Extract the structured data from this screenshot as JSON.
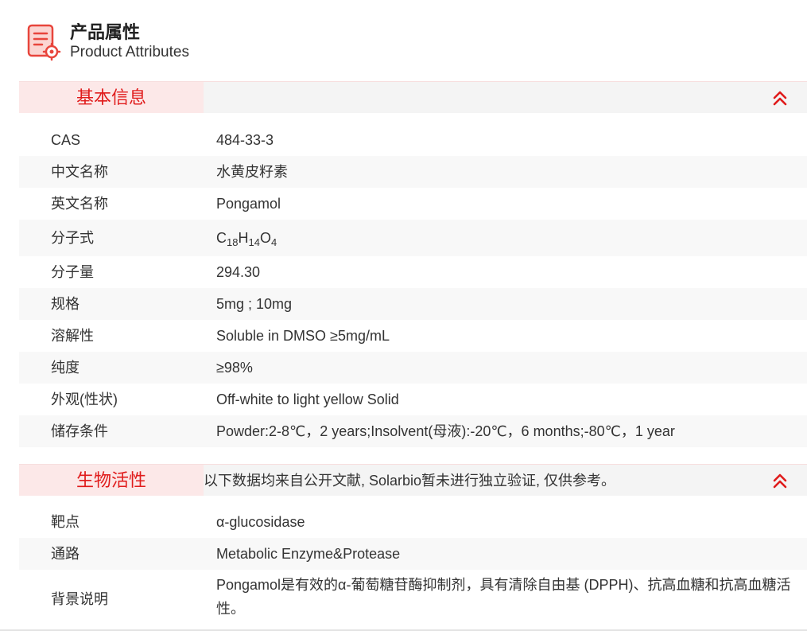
{
  "header": {
    "title": "产品属性",
    "subtitle": "Product Attributes",
    "icon": "document-settings-icon",
    "accent": "#e8453c"
  },
  "basic_info": {
    "tab_label": "基本信息",
    "collapse_icon": "double-chevron-up-icon",
    "rows": [
      {
        "label": "CAS",
        "value": "484-33-3"
      },
      {
        "label": "中文名称",
        "value": "水黄皮籽素"
      },
      {
        "label": "英文名称",
        "value": "Pongamol"
      },
      {
        "label": "分子式",
        "value": "C18H14O4",
        "formula": {
          "c": "C",
          "c_n": "18",
          "h": "H",
          "h_n": "14",
          "o": "O",
          "o_n": "4"
        }
      },
      {
        "label": "分子量",
        "value": "294.30"
      },
      {
        "label": "规格",
        "value": "5mg ; 10mg"
      },
      {
        "label": "溶解性",
        "value": "Soluble in DMSO ≥5mg/mL"
      },
      {
        "label": "纯度",
        "value": "≥98%"
      },
      {
        "label": "外观(性状)",
        "value": "Off-white to light yellow Solid"
      },
      {
        "label": "储存条件",
        "value": "Powder:2-8℃，2 years;Insolvent(母液):-20℃，6 months;-80℃，1 year"
      }
    ]
  },
  "bio_activity": {
    "tab_label": "生物活性",
    "note": "以下数据均来自公开文献, Solarbio暂未进行独立验证, 仅供参考。",
    "collapse_icon": "double-chevron-up-icon",
    "rows": [
      {
        "label": "靶点",
        "value": "α-glucosidase"
      },
      {
        "label": "通路",
        "value": "Metabolic Enzyme&Protease"
      },
      {
        "label": "背景说明",
        "value": "Pongamol是有效的α-葡萄糖苷酶抑制剂，具有清除自由基 (DPPH)、抗高血糖和抗高血糖活性。"
      }
    ]
  },
  "colors": {
    "tab_bg": "#fce8e8",
    "tab_text": "#e01b1b",
    "bar_bg": "#f4f4f4",
    "row_alt_bg": "#f8f8f8"
  }
}
